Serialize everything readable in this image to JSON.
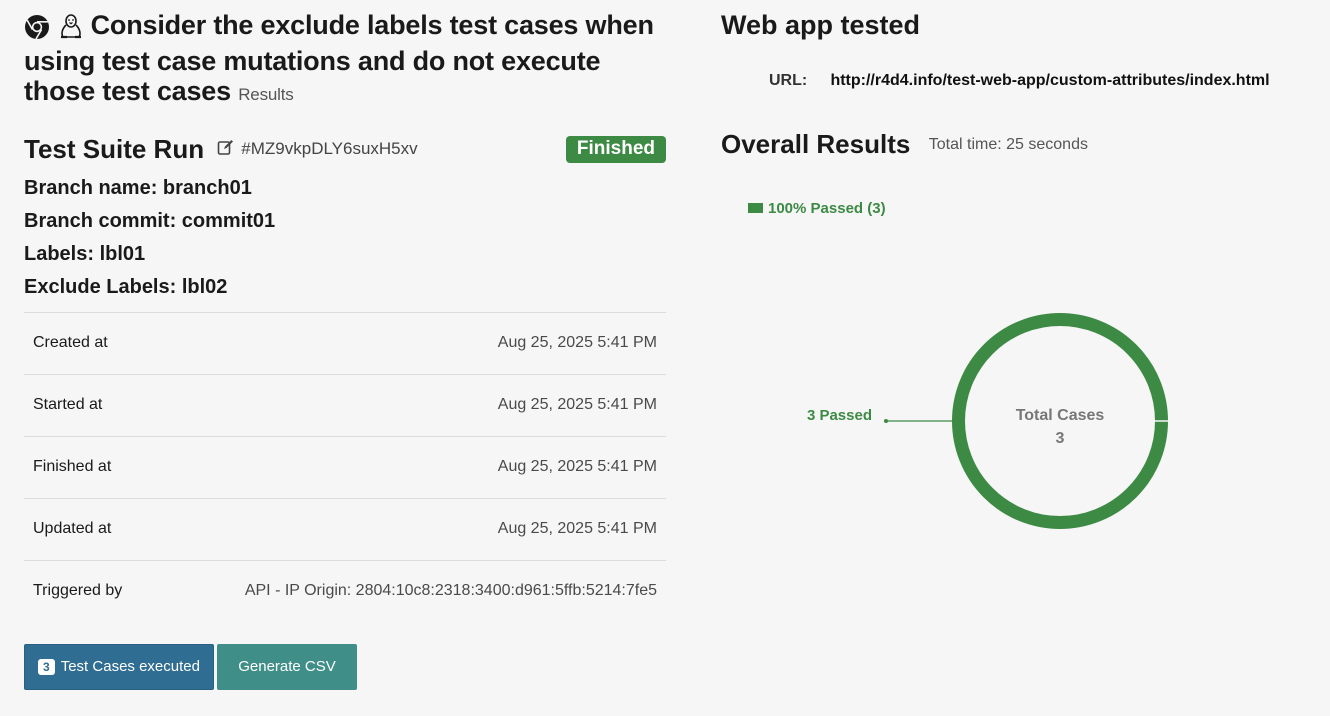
{
  "page": {
    "title": "Consider the exclude labels test cases when using test case mutations and do not execute those test cases",
    "title_suffix": "Results",
    "icons": [
      "chrome-icon",
      "linux-icon"
    ]
  },
  "suite": {
    "heading": "Test Suite Run",
    "id": "#MZ9vkpDLY6suxH5xv",
    "status": "Finished",
    "status_color": "#3d8a45",
    "branch_name": "Branch name: branch01",
    "branch_commit": "Branch commit: commit01",
    "labels": "Labels: lbl01",
    "exclude_labels": "Exclude Labels: lbl02"
  },
  "details": [
    {
      "key": "Created at",
      "value": "Aug 25, 2025 5:41 PM"
    },
    {
      "key": "Started at",
      "value": "Aug 25, 2025 5:41 PM"
    },
    {
      "key": "Finished at",
      "value": "Aug 25, 2025 5:41 PM"
    },
    {
      "key": "Updated at",
      "value": "Aug 25, 2025 5:41 PM"
    },
    {
      "key": "Triggered by",
      "value": "API - IP Origin: 2804:10c8:2318:3400:d961:5ffb:5214:7fe5"
    }
  ],
  "buttons": {
    "executed_count": "3",
    "executed_label": "Test Cases executed",
    "csv_label": "Generate CSV"
  },
  "app": {
    "heading": "Web app tested",
    "url_label": "URL:",
    "url": "http://r4d4.info/test-web-app/custom-attributes/index.html"
  },
  "results": {
    "heading": "Overall Results",
    "total_time": "Total time: 25 seconds",
    "legend": "100% Passed (3)"
  },
  "chart_data": {
    "type": "pie",
    "categories": [
      "Passed"
    ],
    "values": [
      3
    ],
    "colors": [
      "#3d8a45"
    ],
    "legend": [
      "100% Passed (3)"
    ],
    "legend_position": "top-left",
    "slice_labels": [
      "3 Passed"
    ],
    "center_label": "Total Cases",
    "center_value": "3"
  }
}
